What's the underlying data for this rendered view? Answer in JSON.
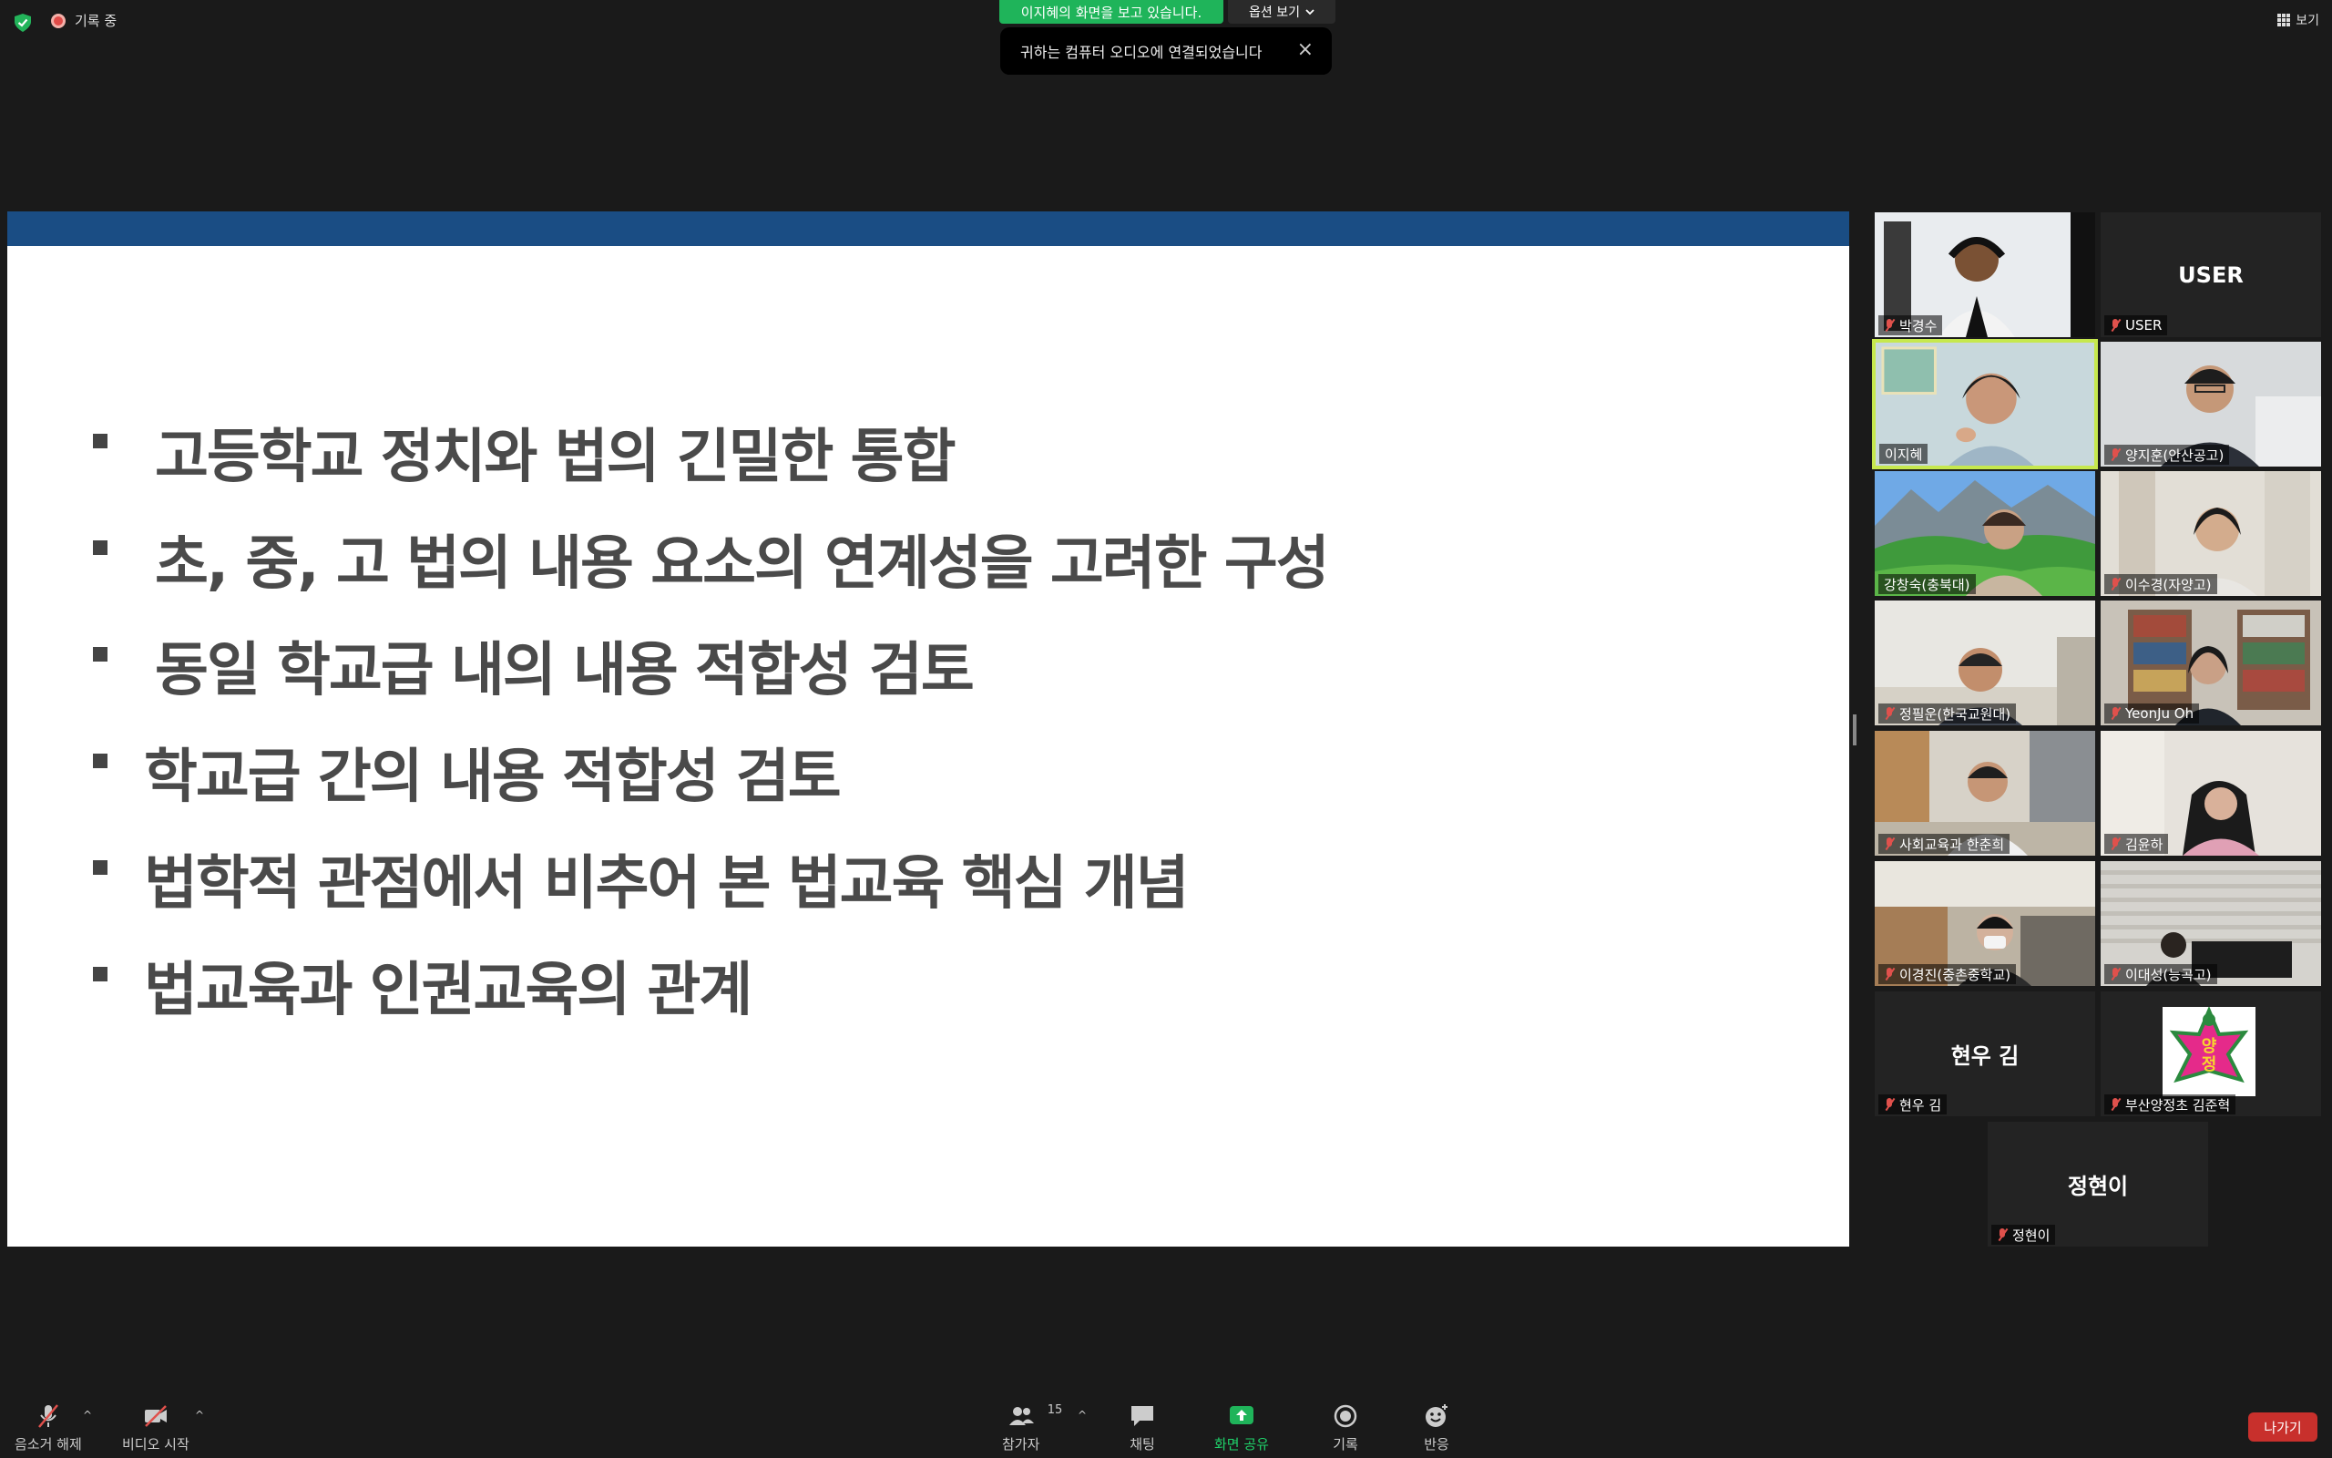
{
  "top": {
    "recording_label": "기록 중",
    "viewing_banner": "이지혜의 화면을 보고 있습니다.",
    "view_options_label": "옵션 보기",
    "toast_message": "귀하는 컴퓨터 오디오에 연결되었습니다",
    "toast_close": "×",
    "view_label": "보기"
  },
  "slide": {
    "bullets": [
      " 고등학교 정치와 법의 긴밀한 통합",
      " 초, 중, 고 법의 내용 요소의 연계성을 고려한 구성",
      " 동일 학교급 내의 내용 적합성 검토",
      "학교급 간의 내용 적합성 검토",
      "법학적 관점에서 비추어 본 법교육 핵심 개념",
      "법교육과 인권교육의 관계"
    ],
    "bullet_marker": "▪"
  },
  "participants": [
    {
      "name": "박경수",
      "muted": true,
      "video": true,
      "active": false
    },
    {
      "name": "USER",
      "muted": true,
      "video": false,
      "display": "USER",
      "active": false
    },
    {
      "name": "이지혜",
      "muted": false,
      "video": true,
      "active": true
    },
    {
      "name": "양지훈(안산공고)",
      "muted": true,
      "video": true,
      "active": false
    },
    {
      "name": "강창숙(충북대)",
      "muted": false,
      "video": true,
      "active": false
    },
    {
      "name": "이수경(자양고)",
      "muted": true,
      "video": true,
      "active": false
    },
    {
      "name": "정필운(한국교원대)",
      "muted": true,
      "video": true,
      "active": false
    },
    {
      "name": "YeonJu Oh",
      "muted": true,
      "video": true,
      "active": false
    },
    {
      "name": "사회교육과 한춘희",
      "muted": true,
      "video": true,
      "active": false
    },
    {
      "name": "김윤하",
      "muted": true,
      "video": true,
      "active": false
    },
    {
      "name": "이경진(중촌중학교)",
      "muted": true,
      "video": true,
      "active": false
    },
    {
      "name": "이대성(능곡고)",
      "muted": true,
      "video": true,
      "active": false
    },
    {
      "name": "현우 김",
      "muted": true,
      "video": false,
      "display": "현우 김",
      "active": false
    },
    {
      "name": "부산양정초 김준혁",
      "muted": true,
      "video": false,
      "logo_text": "양정",
      "active": false
    },
    {
      "name": "정현이",
      "muted": true,
      "video": false,
      "display": "정현이",
      "active": false
    }
  ],
  "toolbar": {
    "unmute_label": "음소거 해제",
    "video_label": "비디오 시작",
    "participants_label": "참가자",
    "participants_count": "15",
    "chat_label": "채팅",
    "share_label": "화면 공유",
    "record_label": "기록",
    "reactions_label": "반응",
    "leave_label": "나가기",
    "caret": "^"
  },
  "colors": {
    "slide_header": "#1a4d84",
    "share_green": "#1fb45a",
    "active_speaker": "#c6e84e",
    "leave_red": "#c8302c",
    "bullet_text": "#4a4a4a"
  }
}
